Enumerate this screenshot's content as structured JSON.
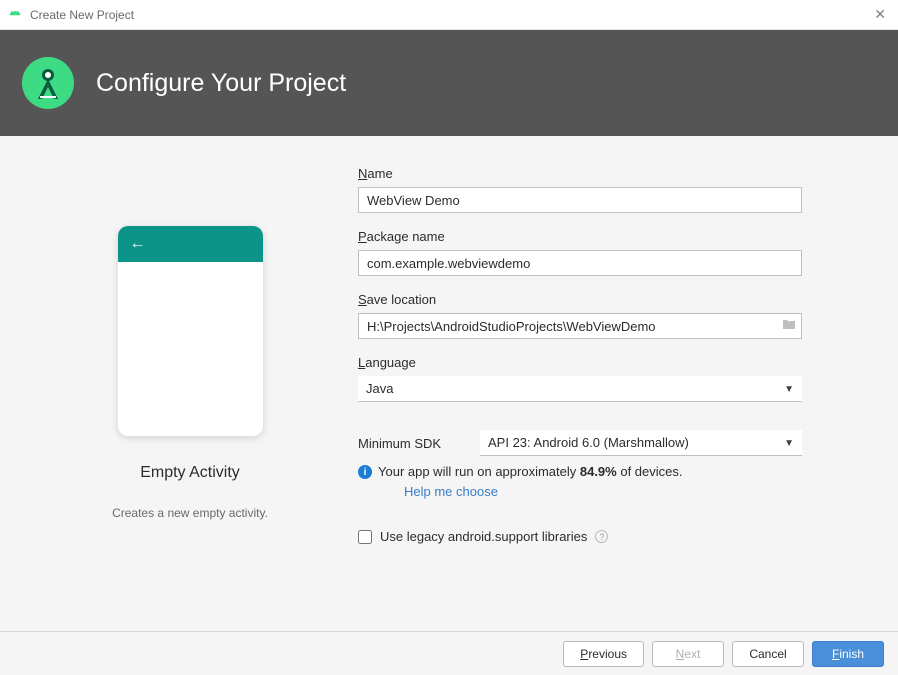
{
  "window": {
    "title": "Create New Project"
  },
  "header": {
    "title": "Configure Your Project"
  },
  "preview": {
    "templateName": "Empty Activity",
    "templateDesc": "Creates a new empty activity."
  },
  "fields": {
    "nameLabel": "Name",
    "nameValue": "WebView Demo",
    "packageLabel": "Package name",
    "packageValue": "com.example.webviewdemo",
    "locationLabel": "Save location",
    "locationValue": "H:\\Projects\\AndroidStudioProjects\\WebViewDemo",
    "languageLabel": "Language",
    "languageValue": "Java",
    "sdkLabel": "Minimum SDK",
    "sdkValue": "API 23: Android 6.0 (Marshmallow)",
    "infoPrefix": "Your app will run on approximately ",
    "infoPercent": "84.9%",
    "infoSuffix": " of devices.",
    "helpLink": "Help me choose",
    "legacyLabel": "Use legacy android.support libraries"
  },
  "footer": {
    "previous": "Previous",
    "next": "Next",
    "cancel": "Cancel",
    "finish": "Finish"
  }
}
